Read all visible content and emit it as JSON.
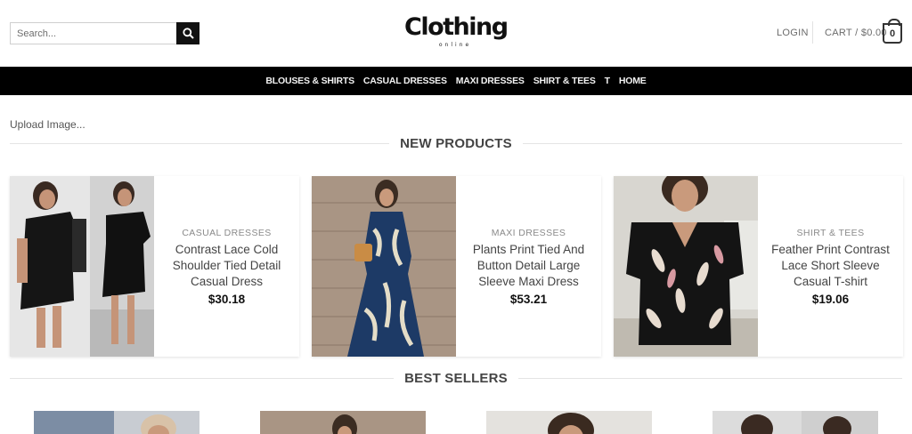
{
  "header": {
    "search_placeholder": "Search...",
    "logo_text": "Clothing",
    "logo_subtext": "online",
    "login_label": "LOGIN",
    "cart_label": "CART / $0.00",
    "cart_count": "0"
  },
  "nav": {
    "items": [
      "BLOUSES & SHIRTS",
      "CASUAL DRESSES",
      "MAXI DRESSES",
      "SHIRT & TEES",
      "T",
      "HOME"
    ]
  },
  "upload_label": "Upload Image...",
  "sections": {
    "new_products": "NEW PRODUCTS",
    "best_sellers": "BEST SELLERS"
  },
  "products": [
    {
      "category": "CASUAL DRESSES",
      "name": "Contrast Lace Cold Shoulder Tied Detail Casual Dress",
      "price": "$30.18"
    },
    {
      "category": "MAXI DRESSES",
      "name": "Plants Print Tied And Button Detail Large Sleeve Maxi Dress",
      "price": "$53.21"
    },
    {
      "category": "SHIRT & TEES",
      "name": "Feather Print Contrast Lace Short Sleeve Casual T-shirt",
      "price": "$19.06"
    }
  ],
  "colors": {
    "nav_bg": "#000000",
    "accent": "#111111"
  },
  "icons": {
    "search": "search-icon",
    "cart": "cart-bag-icon"
  }
}
